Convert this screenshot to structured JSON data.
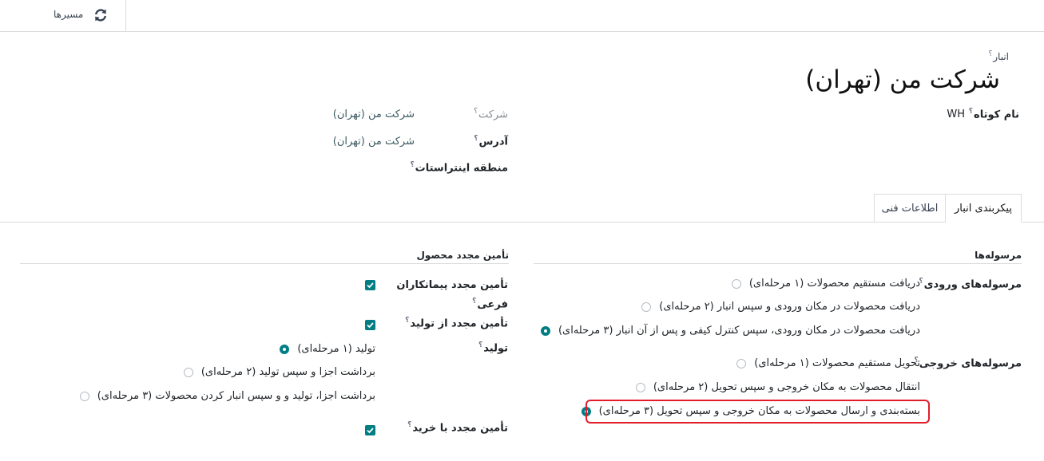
{
  "toolbar": {
    "routes_label": "مسیرها"
  },
  "header": {
    "breadcrumb_label": "انبار",
    "title": "شرکت من (تهران)"
  },
  "fields": {
    "short_name_label": "نام کوتاه",
    "short_name_value": "WH",
    "company_label": "شرکت",
    "company_value": "شرکت من (تهران)",
    "address_label": "آدرس",
    "address_value": "شرکت من (تهران)",
    "intrastat_label": "منطقه اینتراستات"
  },
  "tabs": [
    {
      "label": "پیکربندی انبار",
      "active": true
    },
    {
      "label": "اطلاعات فنی",
      "active": false
    }
  ],
  "shipments": {
    "heading": "مرسوله‌ها",
    "incoming_label": "مرسوله‌های ورودی",
    "incoming_options": [
      {
        "label": "دریافت مستقیم محصولات (۱ مرحله‌ای)",
        "selected": false
      },
      {
        "label": "دریافت محصولات در مکان ورودی و سپس انبار (۲ مرحله‌ای)",
        "selected": false
      },
      {
        "label": "دریافت محصولات در مکان ورودی، سپس کنترل کیفی و پس از آن انبار (۳ مرحله‌ای)",
        "selected": true
      }
    ],
    "outgoing_label": "مرسوله‌های خروجی",
    "outgoing_options": [
      {
        "label": "تحویل مستقیم محصولات (۱ مرحله‌ای)",
        "selected": false
      },
      {
        "label": "انتقال محصولات به مکان خروجی و سپس تحویل (۲ مرحله‌ای)",
        "selected": false
      },
      {
        "label": "بسته‌بندی و ارسال محصولات به مکان خروجی و سپس تحویل (۳ مرحله‌ای)",
        "selected": true
      }
    ]
  },
  "replenishment": {
    "heading": "تأمین مجدد محصول",
    "subcontractor_label_line1": "تأمین مجدد پیمانکاران",
    "subcontractor_label_line2": "فرعی",
    "subcontractor_checked": true,
    "manufacture_label": "تأمین مجدد از تولید",
    "manufacture_checked": true,
    "production_label": "تولید",
    "production_options": [
      {
        "label": "تولید (۱ مرحله‌ای)",
        "selected": true
      },
      {
        "label": "برداشت اجزا و سپس تولید (۲ مرحله‌ای)",
        "selected": false
      },
      {
        "label": "برداشت اجزا، تولید و و سپس انبار کردن محصولات (۳ مرحله‌ای)",
        "selected": false
      }
    ],
    "buy_label": "تأمین مجدد با خرید",
    "buy_checked": true
  },
  "tooltip_mark": "؟",
  "colors": {
    "accent": "#017e84",
    "highlight": "#e11d2a",
    "link_value": "#3c5a61"
  }
}
